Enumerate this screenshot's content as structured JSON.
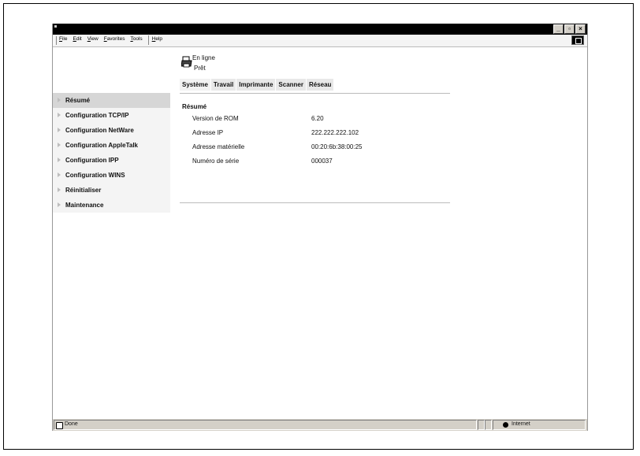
{
  "menu": {
    "items": [
      "File",
      "Edit",
      "View",
      "Favorites",
      "Tools",
      "Help"
    ]
  },
  "printer_status": {
    "line1": "En ligne",
    "line2": "Prêt"
  },
  "tabs": [
    "Système",
    "Travail",
    "Imprimante",
    "Scanner",
    "Réseau"
  ],
  "sidebar": {
    "items": [
      "Résumé",
      "Configuration TCP/IP",
      "Configuration NetWare",
      "Configuration AppleTalk",
      "Configuration IPP",
      "Configuration WINS",
      "Réinitialiser",
      "Maintenance"
    ]
  },
  "summary": {
    "title": "Résumé",
    "rows": [
      {
        "label": "Version de ROM",
        "value": "6.20"
      },
      {
        "label": "Adresse IP",
        "value": "222.222.222.102"
      },
      {
        "label": "Adresse matérielle",
        "value": "00:20:6b:38:00:25"
      },
      {
        "label": "Numéro de série",
        "value": "000037"
      }
    ]
  },
  "statusbar": {
    "left": "Done",
    "zone": "Internet"
  },
  "icons": {
    "printer": "printer-icon",
    "done": "page-done-icon",
    "zone": "globe-icon",
    "throbber": "windows-logo-icon",
    "sidebar_arrow": "triangle-right-icon"
  }
}
